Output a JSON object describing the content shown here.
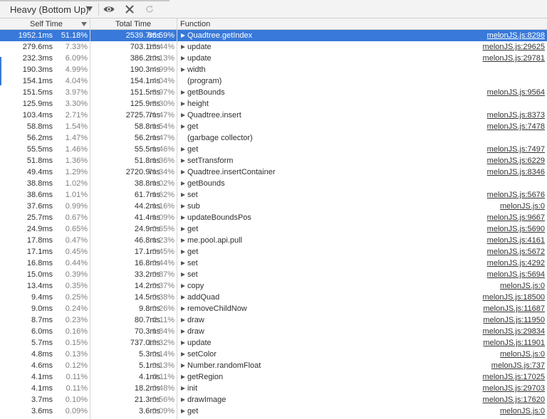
{
  "toolbar": {
    "view_mode": "Heavy (Bottom Up)",
    "icons": [
      "chevron-down-icon",
      "eye-icon",
      "close-icon",
      "reload-icon"
    ]
  },
  "columns": {
    "self_time": "Self Time",
    "total_time": "Total Time",
    "function": "Function"
  },
  "colors": {
    "selected_row_bg": "#3879d9",
    "header_bg": "#f3f3f3",
    "percent_text": "#808080"
  },
  "rows": [
    {
      "self_ms": "1952.1ms",
      "self_pct": "51.18%",
      "total_ms": "2539.7ms",
      "total_pct": "66.59%",
      "name": "Quadtree.getIndex",
      "url": "melonJS.js:8298",
      "expandable": true,
      "selected": true
    },
    {
      "self_ms": "279.6ms",
      "self_pct": "7.33%",
      "total_ms": "703.1ms",
      "total_pct": "18.44%",
      "name": "update",
      "url": "melonJS.js:29625",
      "expandable": true
    },
    {
      "self_ms": "232.3ms",
      "self_pct": "6.09%",
      "total_ms": "386.2ms",
      "total_pct": "10.13%",
      "name": "update",
      "url": "melonJS.js:29781",
      "expandable": true
    },
    {
      "self_ms": "190.3ms",
      "self_pct": "4.99%",
      "total_ms": "190.3ms",
      "total_pct": "4.99%",
      "name": "width",
      "url": "",
      "expandable": true
    },
    {
      "self_ms": "154.1ms",
      "self_pct": "4.04%",
      "total_ms": "154.1ms",
      "total_pct": "4.04%",
      "name": "(program)",
      "url": "",
      "expandable": false
    },
    {
      "self_ms": "151.5ms",
      "self_pct": "3.97%",
      "total_ms": "151.5ms",
      "total_pct": "3.97%",
      "name": "getBounds",
      "url": "melonJS.js:9564",
      "expandable": true
    },
    {
      "self_ms": "125.9ms",
      "self_pct": "3.30%",
      "total_ms": "125.9ms",
      "total_pct": "3.30%",
      "name": "height",
      "url": "",
      "expandable": true
    },
    {
      "self_ms": "103.4ms",
      "self_pct": "2.71%",
      "total_ms": "2725.7ms",
      "total_pct": "71.47%",
      "name": "Quadtree.insert",
      "url": "melonJS.js:8373",
      "expandable": true
    },
    {
      "self_ms": "58.8ms",
      "self_pct": "1.54%",
      "total_ms": "58.8ms",
      "total_pct": "1.54%",
      "name": "get",
      "url": "melonJS.js:7478",
      "expandable": true
    },
    {
      "self_ms": "56.2ms",
      "self_pct": "1.47%",
      "total_ms": "56.2ms",
      "total_pct": "1.47%",
      "name": "(garbage collector)",
      "url": "",
      "expandable": false
    },
    {
      "self_ms": "55.5ms",
      "self_pct": "1.46%",
      "total_ms": "55.5ms",
      "total_pct": "1.46%",
      "name": "get",
      "url": "melonJS.js:7497",
      "expandable": true
    },
    {
      "self_ms": "51.8ms",
      "self_pct": "1.36%",
      "total_ms": "51.8ms",
      "total_pct": "1.36%",
      "name": "setTransform",
      "url": "melonJS.js:6229",
      "expandable": true
    },
    {
      "self_ms": "49.4ms",
      "self_pct": "1.29%",
      "total_ms": "2720.9ms",
      "total_pct": "71.34%",
      "name": "Quadtree.insertContainer",
      "url": "melonJS.js:8346",
      "expandable": true
    },
    {
      "self_ms": "38.8ms",
      "self_pct": "1.02%",
      "total_ms": "38.8ms",
      "total_pct": "1.02%",
      "name": "getBounds",
      "url": "",
      "expandable": true
    },
    {
      "self_ms": "38.6ms",
      "self_pct": "1.01%",
      "total_ms": "61.7ms",
      "total_pct": "1.62%",
      "name": "set",
      "url": "melonJS.js:5676",
      "expandable": true
    },
    {
      "self_ms": "37.6ms",
      "self_pct": "0.99%",
      "total_ms": "44.2ms",
      "total_pct": "1.16%",
      "name": "sub",
      "url": "melonJS.js:0",
      "expandable": true
    },
    {
      "self_ms": "25.7ms",
      "self_pct": "0.67%",
      "total_ms": "41.4ms",
      "total_pct": "1.09%",
      "name": "updateBoundsPos",
      "url": "melonJS.js:9667",
      "expandable": true
    },
    {
      "self_ms": "24.9ms",
      "self_pct": "0.65%",
      "total_ms": "24.9ms",
      "total_pct": "0.65%",
      "name": "get",
      "url": "melonJS.js:5690",
      "expandable": true
    },
    {
      "self_ms": "17.8ms",
      "self_pct": "0.47%",
      "total_ms": "46.8ms",
      "total_pct": "1.23%",
      "name": "me.pool.api.pull",
      "url": "melonJS.js:4161",
      "expandable": true
    },
    {
      "self_ms": "17.1ms",
      "self_pct": "0.45%",
      "total_ms": "17.1ms",
      "total_pct": "0.45%",
      "name": "get",
      "url": "melonJS.js:5672",
      "expandable": true
    },
    {
      "self_ms": "16.8ms",
      "self_pct": "0.44%",
      "total_ms": "16.8ms",
      "total_pct": "0.44%",
      "name": "set",
      "url": "melonJS.js:4292",
      "expandable": true
    },
    {
      "self_ms": "15.0ms",
      "self_pct": "0.39%",
      "total_ms": "33.2ms",
      "total_pct": "0.87%",
      "name": "set",
      "url": "melonJS.js:5694",
      "expandable": true
    },
    {
      "self_ms": "13.4ms",
      "self_pct": "0.35%",
      "total_ms": "14.2ms",
      "total_pct": "0.37%",
      "name": "copy",
      "url": "melonJS.js:0",
      "expandable": true
    },
    {
      "self_ms": "9.4ms",
      "self_pct": "0.25%",
      "total_ms": "14.5ms",
      "total_pct": "0.38%",
      "name": "addQuad",
      "url": "melonJS.js:18500",
      "expandable": true
    },
    {
      "self_ms": "9.0ms",
      "self_pct": "0.24%",
      "total_ms": "9.8ms",
      "total_pct": "0.26%",
      "name": "removeChildNow",
      "url": "melonJS.js:11687",
      "expandable": true
    },
    {
      "self_ms": "8.7ms",
      "self_pct": "0.23%",
      "total_ms": "80.7ms",
      "total_pct": "2.11%",
      "name": "draw",
      "url": "melonJS.js:11950",
      "expandable": true
    },
    {
      "self_ms": "6.0ms",
      "self_pct": "0.16%",
      "total_ms": "70.3ms",
      "total_pct": "1.84%",
      "name": "draw",
      "url": "melonJS.js:29834",
      "expandable": true
    },
    {
      "self_ms": "5.7ms",
      "self_pct": "0.15%",
      "total_ms": "737.0ms",
      "total_pct": "19.32%",
      "name": "update",
      "url": "melonJS.js:11901",
      "expandable": true
    },
    {
      "self_ms": "4.8ms",
      "self_pct": "0.13%",
      "total_ms": "5.3ms",
      "total_pct": "0.14%",
      "name": "setColor",
      "url": "melonJS.js:0",
      "expandable": true
    },
    {
      "self_ms": "4.6ms",
      "self_pct": "0.12%",
      "total_ms": "5.1ms",
      "total_pct": "0.13%",
      "name": "Number.randomFloat",
      "url": "melonJS.js:737",
      "expandable": true
    },
    {
      "self_ms": "4.1ms",
      "self_pct": "0.11%",
      "total_ms": "4.1ms",
      "total_pct": "0.11%",
      "name": "getRegion",
      "url": "melonJS.js:17025",
      "expandable": true
    },
    {
      "self_ms": "4.1ms",
      "self_pct": "0.11%",
      "total_ms": "18.2ms",
      "total_pct": "0.48%",
      "name": "init",
      "url": "melonJS.js:29703",
      "expandable": true
    },
    {
      "self_ms": "3.7ms",
      "self_pct": "0.10%",
      "total_ms": "21.3ms",
      "total_pct": "0.56%",
      "name": "drawImage",
      "url": "melonJS.js:17620",
      "expandable": true
    },
    {
      "self_ms": "3.6ms",
      "self_pct": "0.09%",
      "total_ms": "3.6ms",
      "total_pct": "0.09%",
      "name": "get",
      "url": "melonJS.js:0",
      "expandable": true
    }
  ]
}
